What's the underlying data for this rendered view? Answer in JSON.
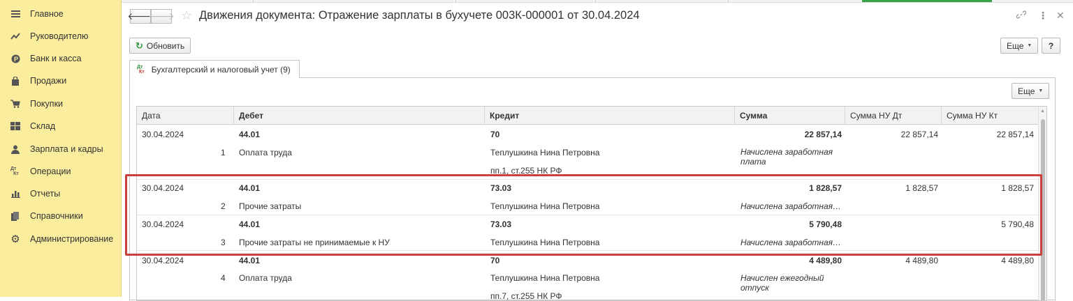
{
  "sidebar": {
    "items": [
      {
        "label": "Главное",
        "icon": "menu-icon"
      },
      {
        "label": "Руководителю",
        "icon": "trend-icon"
      },
      {
        "label": "Банк и касса",
        "icon": "coin-icon"
      },
      {
        "label": "Продажи",
        "icon": "bag-icon"
      },
      {
        "label": "Покупки",
        "icon": "cart-icon"
      },
      {
        "label": "Склад",
        "icon": "warehouse-icon"
      },
      {
        "label": "Зарплата и кадры",
        "icon": "person-icon"
      },
      {
        "label": "Операции",
        "icon": "dt-kt-icon"
      },
      {
        "label": "Отчеты",
        "icon": "bar-chart-icon"
      },
      {
        "label": "Справочники",
        "icon": "books-icon"
      },
      {
        "label": "Администрирование",
        "icon": "gear-icon"
      }
    ]
  },
  "header": {
    "title": "Движения документа: Отражение зарплаты в бухучете 003К-000001 от 30.04.2024",
    "back": "🡐",
    "forward": "🡒"
  },
  "toolbar": {
    "refresh_label": "Обновить",
    "more_label": "Еще",
    "help_label": "?"
  },
  "tab": {
    "label": "Бухгалтерский и налоговый учет (9)",
    "icon_dt": "Дт",
    "icon_kt": "Кт",
    "more_label": "Еще"
  },
  "table": {
    "columns": [
      "Дата",
      "Дебет",
      "Кредит",
      "Сумма",
      "Сумма НУ Дт",
      "Сумма НУ Кт"
    ],
    "rows": [
      {
        "date": "30.04.2024",
        "num": "1",
        "debit": "44.01",
        "debit_sub": "Оплата труда",
        "credit": "70",
        "credit_sub": "Теплушкина Нина Петровна",
        "credit_sub2": "пп.1, ст.255 НК РФ",
        "sum": "22 857,14",
        "comment": "Начислена заработная плата",
        "nu_dt": "22 857,14",
        "nu_kt": "22 857,14"
      },
      {
        "date": "30.04.2024",
        "num": "2",
        "debit": "44.01",
        "debit_sub": "Прочие затраты",
        "credit": "73.03",
        "credit_sub": "Теплушкина Нина Петровна",
        "sum": "1 828,57",
        "comment": "Начислена заработная…",
        "nu_dt": "1 828,57",
        "nu_kt": "1 828,57"
      },
      {
        "date": "30.04.2024",
        "num": "3",
        "debit": "44.01",
        "debit_sub": "Прочие затраты не принимаемые к НУ",
        "credit": "73.03",
        "credit_sub": "Теплушкина Нина Петровна",
        "sum": "5 790,48",
        "comment": "Начислена заработная…",
        "nu_dt": "",
        "nu_kt": "5 790,48"
      },
      {
        "date": "30.04.2024",
        "num": "4",
        "debit": "44.01",
        "debit_sub": "Оплата труда",
        "credit": "70",
        "credit_sub": "Теплушкина Нина Петровна",
        "credit_sub2": "пп.7, ст.255 НК РФ",
        "sum": "4 489,80",
        "comment": "Начислен ежегодный отпуск",
        "nu_dt": "4 489,80",
        "nu_kt": "4 489,80"
      }
    ]
  },
  "colors": {
    "sidebar_bg": "#fbed9e",
    "highlight": "#c9413a",
    "refresh": "#2e9a3c"
  }
}
